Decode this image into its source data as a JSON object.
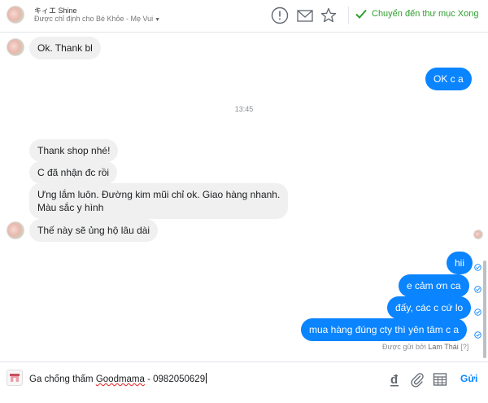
{
  "header": {
    "contact_name": "キィエ Shine",
    "assigned_to": "Được chỉ định cho Bé Khỏe - Mẹ Vui",
    "done_label": "Chuyển đến thư mục Xong"
  },
  "messages": {
    "m1": "Ok. Thank bl",
    "m2": "OK c a",
    "timestamp": "13:45",
    "m3": "Thank shop nhé!",
    "m4": "C đã nhận đc rồi",
    "m5_line1": "Ưng lắm luôn. Đường kim mũi chỉ ok. Giao hàng nhanh.",
    "m5_line2": "Màu sắc y hình",
    "m6": "Thế này sẽ ủng hộ lâu dài",
    "m7": "hii",
    "m8": "e cảm ơn  ca",
    "m9": "đấy, các c cứ lo",
    "m10": "mua hàng đúng cty thì yên tâm c a"
  },
  "sent_by": {
    "prefix": "Được gửi bởi",
    "name": "Lam Thái",
    "help": "[?]"
  },
  "composer": {
    "text_prefix": "Ga chống thấm ",
    "text_underlined": "Goodmama",
    "text_suffix": " - 0982050629",
    "send_label": "Gửi"
  },
  "colors": {
    "outgoing_bubble": "#0a84ff",
    "incoming_bubble": "#f0f0f0",
    "done_green": "#2e9e2e"
  }
}
